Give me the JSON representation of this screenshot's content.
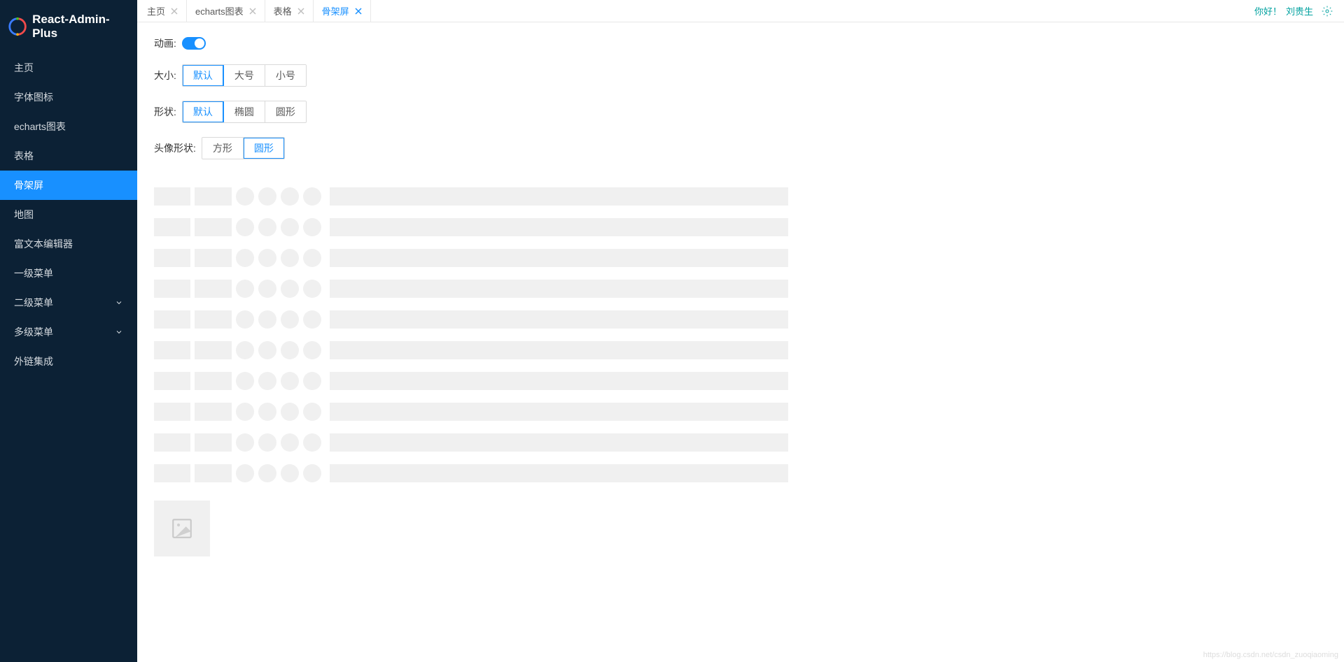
{
  "brand": {
    "title": "React-Admin-Plus"
  },
  "sidebar": {
    "items": [
      {
        "label": "主页",
        "expandable": false
      },
      {
        "label": "字体图标",
        "expandable": false
      },
      {
        "label": "echarts图表",
        "expandable": false
      },
      {
        "label": "表格",
        "expandable": false
      },
      {
        "label": "骨架屏",
        "expandable": false,
        "active": true
      },
      {
        "label": "地图",
        "expandable": false
      },
      {
        "label": "富文本编辑器",
        "expandable": false
      },
      {
        "label": "一级菜单",
        "expandable": false
      },
      {
        "label": "二级菜单",
        "expandable": true
      },
      {
        "label": "多级菜单",
        "expandable": true
      },
      {
        "label": "外链集成",
        "expandable": false
      }
    ]
  },
  "tabs": [
    {
      "label": "主页",
      "active": false
    },
    {
      "label": "echarts图表",
      "active": false
    },
    {
      "label": "表格",
      "active": false
    },
    {
      "label": "骨架屏",
      "active": true
    }
  ],
  "topbar": {
    "greeting": "你好！",
    "username": "刘贵生"
  },
  "controls": {
    "animation": {
      "label": "动画:",
      "on": true
    },
    "size": {
      "label": "大小:",
      "options": [
        "默认",
        "大号",
        "小号"
      ],
      "selected": 0
    },
    "shape": {
      "label": "形状:",
      "options": [
        "默认",
        "椭圆",
        "圆形"
      ],
      "selected": 0
    },
    "avatarShape": {
      "label": "头像形状:",
      "options": [
        "方形",
        "圆形"
      ],
      "selected": 1
    }
  },
  "skeleton": {
    "rows": 10
  },
  "watermark": "https://blog.csdn.net/csdn_zuoqiaoming"
}
